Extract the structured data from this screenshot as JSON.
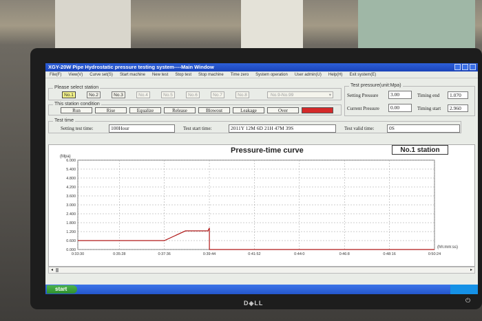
{
  "window": {
    "title": "XGY-20W Pipe Hydrostatic pressure testing system----Main Window"
  },
  "menu": [
    "File(F)",
    "View(V)",
    "Curve set(S)",
    "Start machine",
    "New test",
    "Stop test",
    "Stop machine",
    "Time zero",
    "System operation",
    "User admin(U)",
    "Help(H)",
    "Exit system(E)"
  ],
  "stations": {
    "caption": "Please select station",
    "buttons": [
      "No.1",
      "No.2",
      "No.3",
      "No.4",
      "No.5",
      "No.6",
      "No.7",
      "No.8"
    ],
    "selected": "No.1",
    "dropdown": "No.9-No.99"
  },
  "condition": {
    "caption": "This station condition",
    "items": [
      "Run",
      "Rise",
      "Equalize",
      "Release",
      "Blowout",
      "Leakage",
      "Over"
    ],
    "indicator_color": "#d42a2a"
  },
  "test_time": {
    "caption": "Test time",
    "setting_label": "Setting test time:",
    "setting_value": "100Hour",
    "start_label": "Test start time:",
    "start_value": "2011Y 12M 6D 21H 47M 39S",
    "valid_label": "Test valid time:",
    "valid_value": "0S"
  },
  "pressure": {
    "caption": "Test pressure(unit:Mpa)",
    "setting_label": "Setting Pressure",
    "setting_value": "3.00",
    "current_label": "Current Pressure",
    "current_value": "0.00",
    "timing_end_label": "Timing end",
    "timing_end_value": "1.070",
    "timing_start_label": "Timing start",
    "timing_start_value": "2.960"
  },
  "chart_data": {
    "type": "line",
    "title": "Pressure-time curve",
    "station_label": "No.1 station",
    "ylabel": "(Mpa)",
    "xlabel": "(hh:mm:ss)",
    "yticks": [
      "6.000",
      "5.400",
      "4.800",
      "4.200",
      "3.600",
      "3.000",
      "2.400",
      "1.800",
      "1.200",
      "0.600",
      "0.000"
    ],
    "xticks": [
      "0:33:30",
      "0:35:28",
      "0:37:36",
      "0:39:44",
      "0:41:52",
      "0:44:0",
      "0:46:8",
      "0:48:16",
      "0:50:24"
    ],
    "ylim": [
      0,
      6.0
    ],
    "series": [
      {
        "color": "#b01818",
        "points": [
          [
            "0:33:30",
            0.6
          ],
          [
            "0:37:36",
            0.6
          ],
          [
            "0:38:36",
            1.25
          ],
          [
            "0:39:40",
            1.25
          ],
          [
            "0:39:44",
            1.45
          ],
          [
            "0:39:44",
            0.0
          ],
          [
            "0:50:24",
            0.0
          ]
        ]
      }
    ]
  },
  "taskbar": {
    "start_label": "start"
  }
}
